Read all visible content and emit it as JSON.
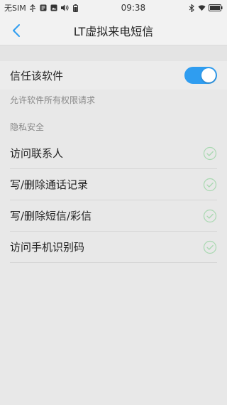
{
  "statusbar": {
    "carrier": "无SIM",
    "time": "09:38",
    "icons_left": [
      "usb-icon",
      "notification-icon",
      "image-icon",
      "volume-icon",
      "battery-icon"
    ],
    "icons_right": [
      "bluetooth-icon",
      "wifi-icon",
      "battery-icon"
    ]
  },
  "header": {
    "title": "LT虚拟来电短信"
  },
  "trust": {
    "label": "信任该软件",
    "enabled": true,
    "description": "允许软件所有权限请求"
  },
  "privacy": {
    "section_title": "隐私安全",
    "items": [
      {
        "label": "访问联系人",
        "checked": true
      },
      {
        "label": "写/删除通话记录",
        "checked": true
      },
      {
        "label": "写/删除短信/彩信",
        "checked": true
      },
      {
        "label": "访问手机识别码",
        "checked": true
      }
    ]
  },
  "colors": {
    "accent": "#2f9df0",
    "check_green": "#a8d8b0",
    "background": "#e8e8e8"
  }
}
